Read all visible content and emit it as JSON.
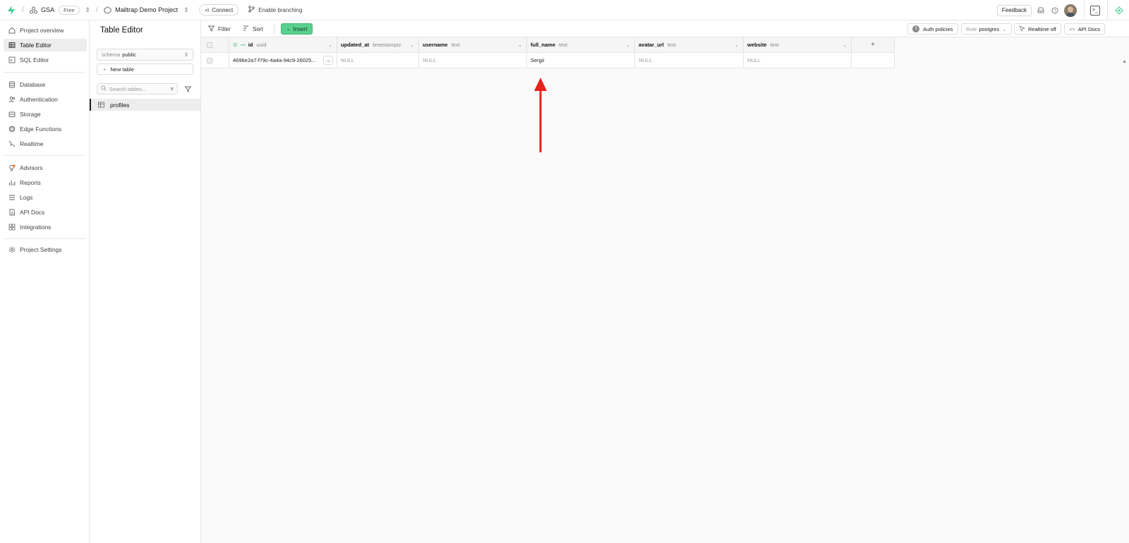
{
  "topbar": {
    "org_name": "GSA",
    "plan_badge": "Free",
    "project_name": "Mailtrap Demo Project",
    "connect_label": "Connect",
    "branching_label": "Enable branching",
    "feedback_label": "Feedback"
  },
  "nav": {
    "items": [
      {
        "label": "Project overview",
        "icon": "home-icon"
      },
      {
        "label": "Table Editor",
        "icon": "table-icon"
      },
      {
        "label": "SQL Editor",
        "icon": "terminal-icon"
      },
      {
        "label": "Database",
        "icon": "database-icon"
      },
      {
        "label": "Authentication",
        "icon": "users-icon"
      },
      {
        "label": "Storage",
        "icon": "storage-icon"
      },
      {
        "label": "Edge Functions",
        "icon": "edge-functions-icon"
      },
      {
        "label": "Realtime",
        "icon": "realtime-icon"
      },
      {
        "label": "Advisors",
        "icon": "lightbulb-icon"
      },
      {
        "label": "Reports",
        "icon": "reports-icon"
      },
      {
        "label": "Logs",
        "icon": "list-icon"
      },
      {
        "label": "API Docs",
        "icon": "file-icon"
      },
      {
        "label": "Integrations",
        "icon": "integrations-icon"
      },
      {
        "label": "Project Settings",
        "icon": "gear-icon"
      }
    ],
    "active": "Table Editor"
  },
  "editor_sidebar": {
    "title": "Table Editor",
    "schema_label": "schema",
    "schema_value": "public",
    "new_table_label": "New table",
    "search_placeholder": "Search tables...",
    "tables": [
      "profiles"
    ]
  },
  "toolbar": {
    "filter_label": "Filter",
    "sort_label": "Sort",
    "insert_label": "Insert",
    "auth_policies_count": "3",
    "auth_policies_label": "Auth policies",
    "role_label": "Role",
    "role_value": "postgres",
    "realtime_label": "Realtime off",
    "api_docs_label": "API Docs"
  },
  "grid": {
    "columns": [
      {
        "name": "id",
        "type": "uuid"
      },
      {
        "name": "updated_at",
        "type": "timestamptz"
      },
      {
        "name": "username",
        "type": "text"
      },
      {
        "name": "full_name",
        "type": "text"
      },
      {
        "name": "avatar_url",
        "type": "text"
      },
      {
        "name": "website",
        "type": "text"
      }
    ],
    "rows": [
      [
        "4696e2a7-f79c-4a4a-94c9-26025...",
        "NULL",
        "NULL",
        "Sergii",
        "NULL",
        "NULL"
      ]
    ]
  },
  "colors": {
    "accent_green": "#5ad08e",
    "annotation_red": "#e8211c"
  }
}
